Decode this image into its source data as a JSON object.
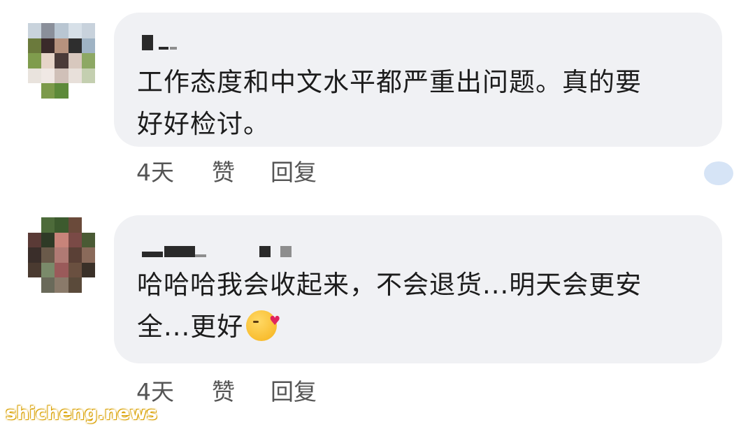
{
  "comments": [
    {
      "text": "工作态度和中文水平都严重出问题。真的要\n好好检讨。",
      "time": "4天",
      "like_label": "赞",
      "reply_label": "回复"
    },
    {
      "text": "哈哈哈我会收起来，不会退货...明天会更安\n全...更好",
      "emoji": "kissing-face-with-heart-emoji",
      "time": "4天",
      "like_label": "赞",
      "reply_label": "回复"
    }
  ],
  "watermark": "shicheng.news",
  "colors": {
    "bubble": "#f0f1f4",
    "text": "#1c1c1c",
    "meta_text": "#555555",
    "watermark_outline": "#d9a000"
  }
}
